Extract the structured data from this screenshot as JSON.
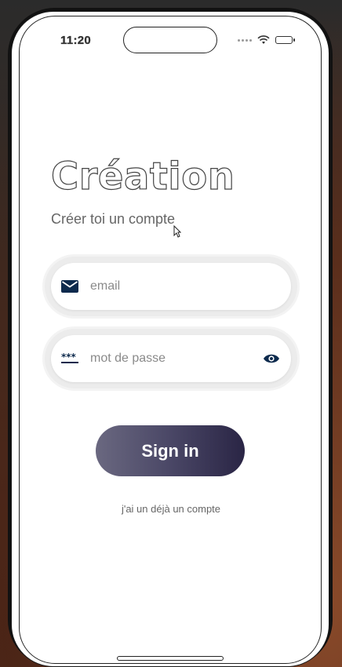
{
  "status_bar": {
    "time": "11:20"
  },
  "header": {
    "title": "Création",
    "subtitle": "Créer toi un compte"
  },
  "form": {
    "email": {
      "value": "",
      "placeholder": "email",
      "icon": "envelope-icon"
    },
    "password": {
      "value": "",
      "placeholder": "mot de passe",
      "icon": "password-dots-icon",
      "toggle_icon": "eye-icon"
    }
  },
  "actions": {
    "sign_in_label": "Sign in",
    "login_link": "j'ai un déjà un compte"
  },
  "colors": {
    "accent_icon": "#0d2a4d",
    "button_start": "#6a6880",
    "button_end": "#2a2545"
  }
}
